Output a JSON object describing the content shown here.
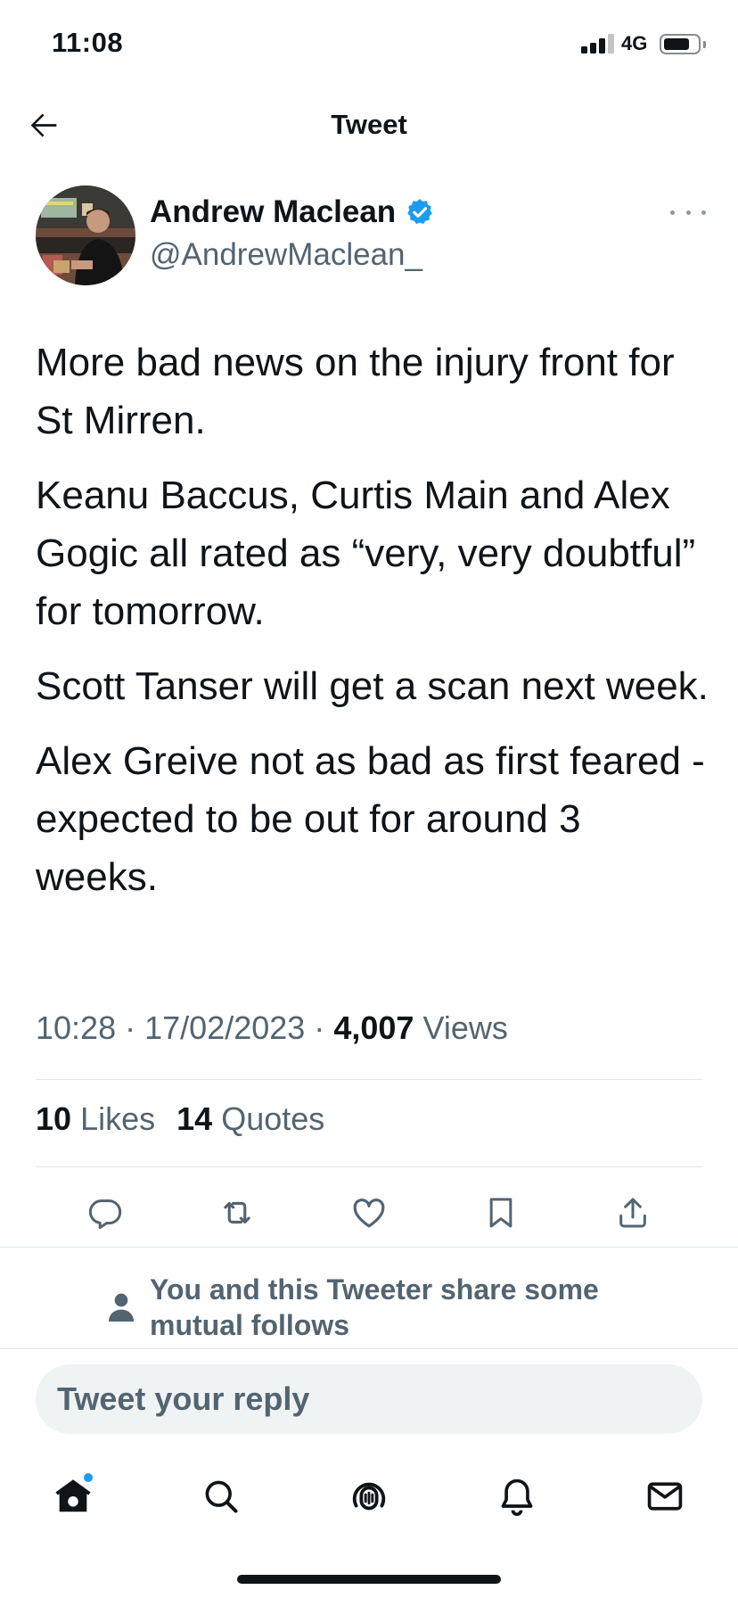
{
  "status_bar": {
    "time": "11:08",
    "network": "4G"
  },
  "header": {
    "title": "Tweet"
  },
  "author": {
    "name": "Andrew Maclean",
    "handle": "@AndrewMaclean_",
    "verified_icon": "verified-badge-icon",
    "accent_color": "#1d9bf0"
  },
  "tweet": {
    "paragraphs": [
      "More bad news on the injury front for St Mirren.",
      "Keanu Baccus, Curtis Main and Alex Gogic all rated as “very, very doubtful” for tomorrow.",
      "Scott Tanser will get a scan next week.",
      "Alex Greive not as bad as first feared - expected to be out for around 3 weeks."
    ],
    "time": "10:28",
    "date": "17/02/2023",
    "separator": "·",
    "views_count": "4,007",
    "views_label": "Views"
  },
  "stats": {
    "likes_count": "10",
    "likes_label": "Likes",
    "quotes_count": "14",
    "quotes_label": "Quotes"
  },
  "actions": [
    "reply-icon",
    "retweet-icon",
    "like-icon",
    "bookmark-icon",
    "share-icon"
  ],
  "mutual": {
    "text": "You and this Tweeter share some mutual follows"
  },
  "reply": {
    "placeholder": "Tweet your reply"
  },
  "tab_bar": [
    "home-icon",
    "search-icon",
    "spaces-icon",
    "notifications-icon",
    "messages-icon"
  ]
}
